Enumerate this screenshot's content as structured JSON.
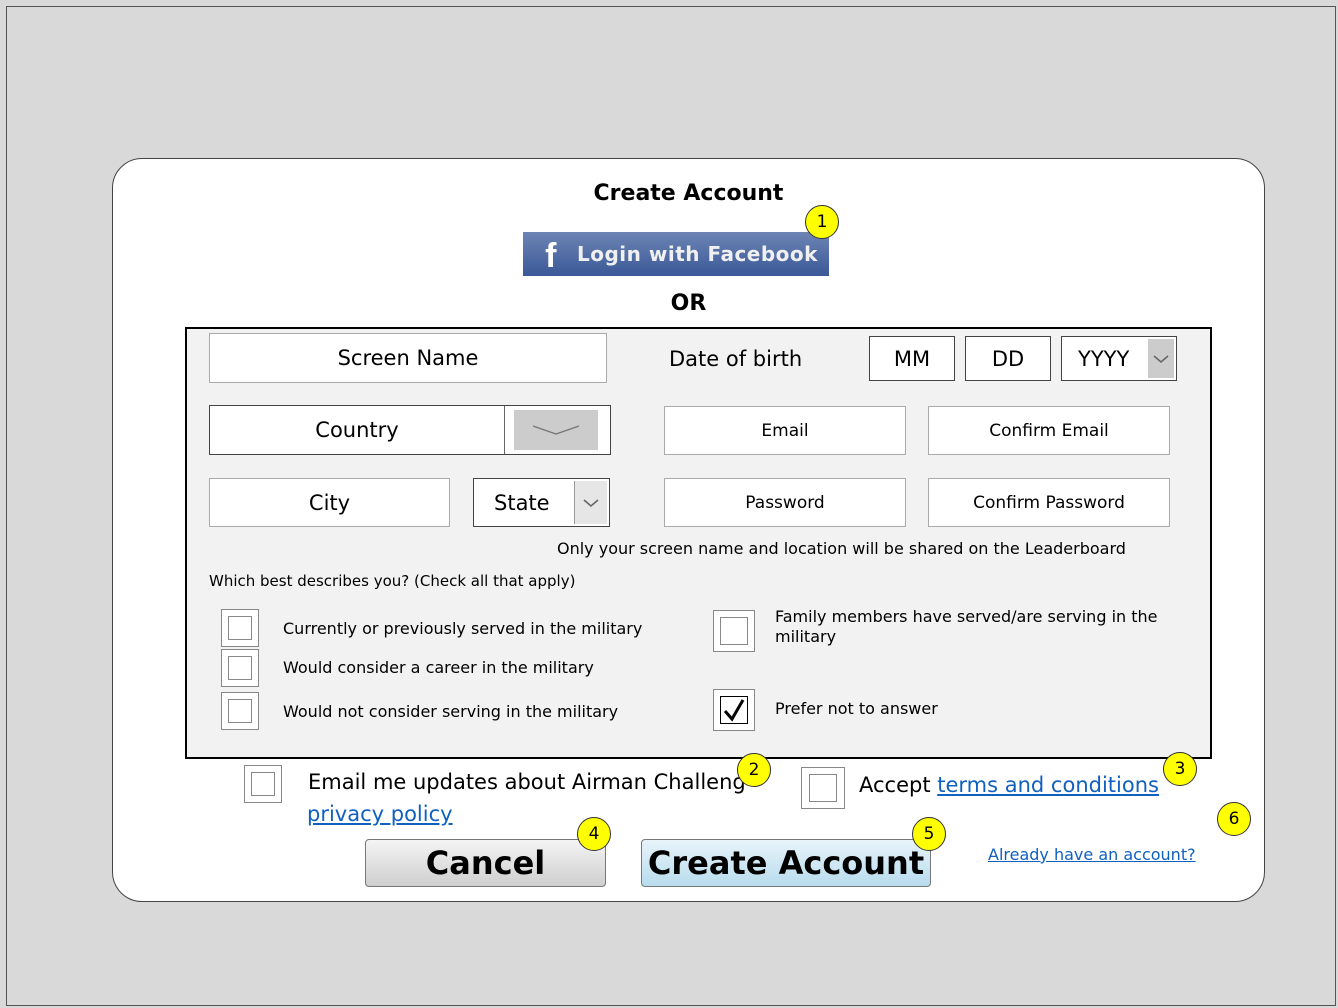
{
  "dialog": {
    "title": "Create Account",
    "facebook_button": {
      "icon_letter": "f",
      "label": "Login with Facebook"
    },
    "or_label": "OR"
  },
  "form": {
    "screen_name": {
      "placeholder": "Screen Name"
    },
    "dob": {
      "label": "Date of birth",
      "month_placeholder": "MM",
      "day_placeholder": "DD",
      "year_placeholder": "YYYY"
    },
    "country": {
      "value": "Country"
    },
    "email": {
      "placeholder": "Email"
    },
    "confirm_email": {
      "placeholder": "Confirm Email"
    },
    "city": {
      "placeholder": "City"
    },
    "state": {
      "value": "State"
    },
    "password": {
      "placeholder": "Password"
    },
    "confirm_password": {
      "placeholder": "Confirm Password"
    },
    "privacy_note": "Only your screen name and location will be shared on the Leaderboard",
    "describe_question": "Which best describes you? (Check all that apply)",
    "options": [
      {
        "label": "Currently or previously served in the military",
        "checked": false
      },
      {
        "label": "Would consider a career in the military",
        "checked": false
      },
      {
        "label": "Would not consider serving in the military",
        "checked": false
      },
      {
        "label": "Family members have served/are serving in the military",
        "checked": false
      },
      {
        "label": "Prefer not to answer",
        "checked": true
      }
    ]
  },
  "footer": {
    "email_updates_label": "Email me updates about Airman Challeng",
    "privacy_policy_link": "privacy policy",
    "accept_prefix": "Accept ",
    "terms_link": "terms and conditions",
    "cancel_label": "Cancel",
    "create_label": "Create Account",
    "already_link": "Already have an account?"
  },
  "annotations": [
    "1",
    "2",
    "3",
    "4",
    "5",
    "6"
  ],
  "colors": {
    "background": "#d9d9d9",
    "facebook_blue": "#3b5998",
    "link": "#1060c0",
    "badge": "#ffff00"
  },
  "icons": {
    "facebook": "facebook-f-icon",
    "dropdown": "chevron-down-icon",
    "checkmark": "checkmark-icon"
  }
}
